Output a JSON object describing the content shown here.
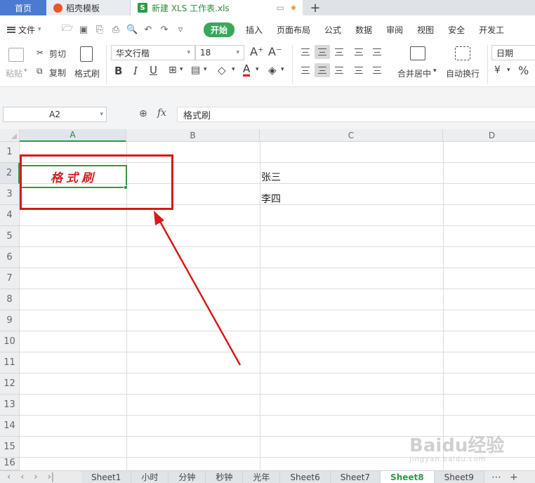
{
  "tabs": {
    "home": "首页",
    "daoke": "稻壳模板",
    "doc": "新建 XLS 工作表.xls",
    "new": "+"
  },
  "menu": {
    "file": "文件",
    "items": [
      "开始",
      "插入",
      "页面布局",
      "公式",
      "数据",
      "审阅",
      "视图",
      "安全",
      "开发工"
    ]
  },
  "ribbon": {
    "paste": "粘贴",
    "cut": "剪切",
    "copy": "复制",
    "format_painter": "格式刷",
    "font_name": "华文行楷",
    "font_size": "18",
    "bold": "B",
    "italic": "I",
    "underline": "U",
    "font_color": "A",
    "merge_center": "合并居中",
    "wrap": "自动换行",
    "number_format": "日期",
    "percent": "%"
  },
  "formula_bar": {
    "name_box": "A2",
    "fx": "fx",
    "content": "格式刷"
  },
  "grid": {
    "columns": [
      "A",
      "B",
      "C",
      "D"
    ],
    "rows": [
      "1",
      "2",
      "3",
      "4",
      "5",
      "6",
      "7",
      "8",
      "9",
      "10",
      "11",
      "12",
      "13",
      "14",
      "15",
      "16"
    ],
    "a2": "格式刷",
    "c2": "张三",
    "c3": "李四"
  },
  "sheets": [
    "Sheet1",
    "小时",
    "分钟",
    "秒钟",
    "光年",
    "Sheet6",
    "Sheet7",
    "Sheet8",
    "Sheet9"
  ],
  "active_sheet": "Sheet8",
  "watermark": {
    "main": "Baidu经验",
    "sub": "jingyan.baidu.com"
  },
  "colors": {
    "accent": "#2e9a48",
    "annotation": "#d61a1a",
    "cell_text": "#d42020"
  }
}
